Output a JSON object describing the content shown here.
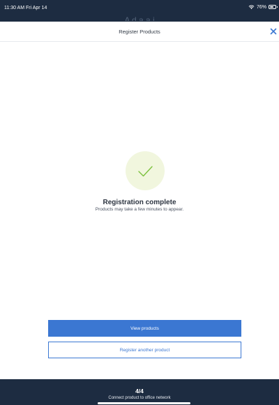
{
  "status_bar": {
    "time": "11:30 AM  Fri Apr 14",
    "battery": "76%",
    "battery_level": 0.76,
    "icons": [
      "wifi-icon",
      "battery-icon"
    ]
  },
  "backdrop": {
    "title_partial": "A d a a i"
  },
  "modal": {
    "title": "Register Products",
    "close_icon": "close-icon",
    "success_icon": "checkmark-icon",
    "heading": "Registration complete",
    "subtitle": "Products may take a few minutes to appear.",
    "primary_button": "View products",
    "secondary_button": "Register another product"
  },
  "footer": {
    "step": "4/4",
    "step_label": "Connect product to office network"
  },
  "colors": {
    "dark_navy": "#1d2c41",
    "primary_blue": "#3b77d2",
    "success_green": "#7cc13d",
    "success_circle_bg": "#f1f6de"
  }
}
